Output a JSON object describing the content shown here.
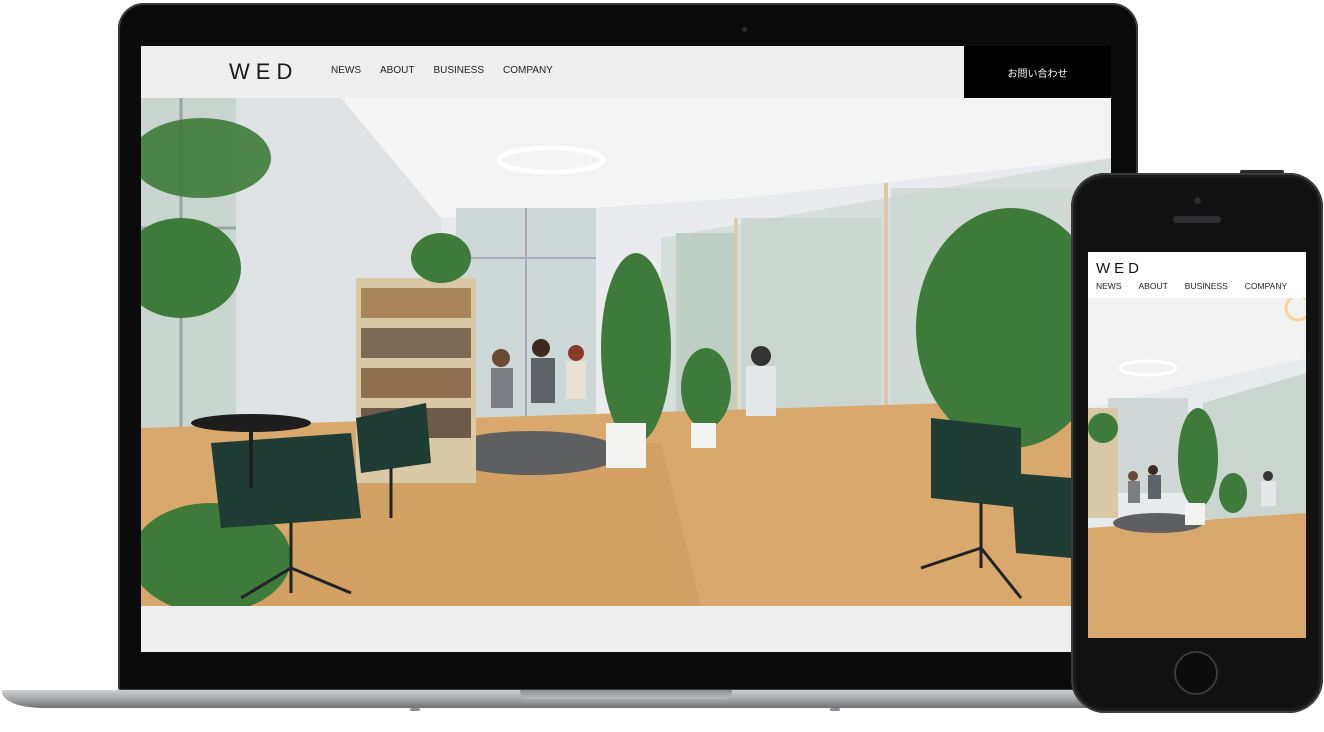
{
  "site": {
    "logo": "WED",
    "nav": [
      "NEWS",
      "ABOUT",
      "BUSINESS",
      "COMPANY"
    ],
    "contact_button": "お問い合わせ"
  },
  "mobile": {
    "logo": "WED",
    "nav": [
      "NEWS",
      "ABOUT",
      "BUSINESS",
      "COMPANY"
    ]
  },
  "colors": {
    "header_bg": "#efefef",
    "contact_bg": "#000000",
    "device_frame": "#0b0b0c"
  },
  "hero_image": "office-lounge-photo"
}
